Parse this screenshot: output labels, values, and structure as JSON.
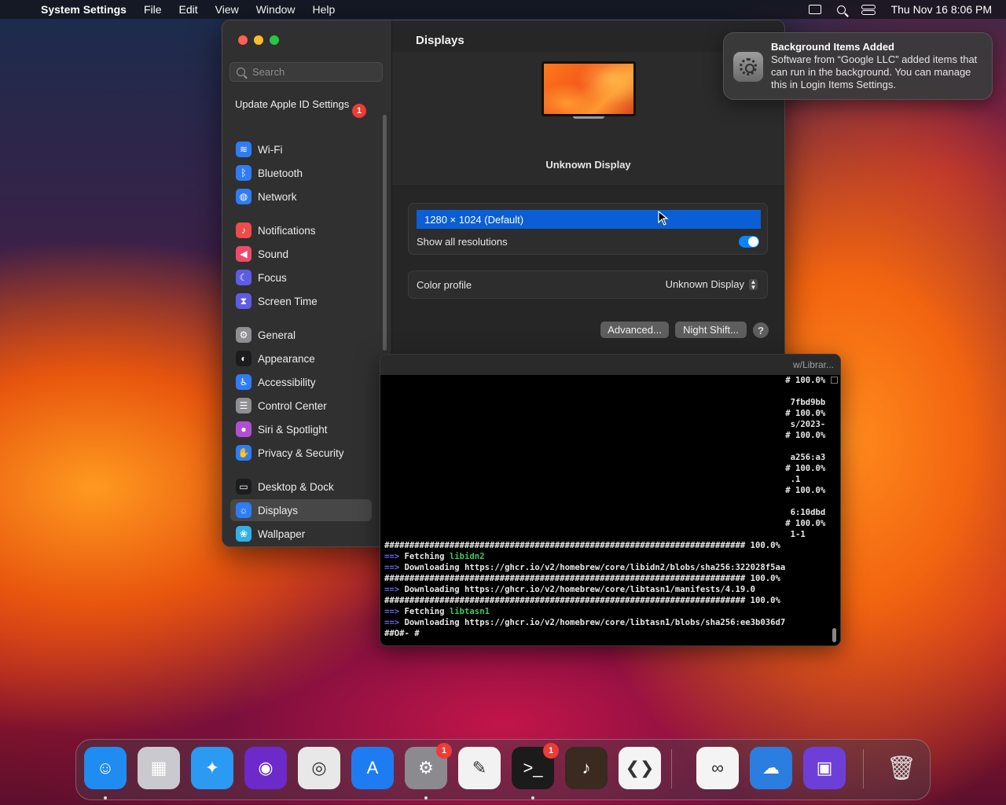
{
  "menubar": {
    "apple": "",
    "app_name": "System Settings",
    "menus": [
      "File",
      "Edit",
      "View",
      "Window",
      "Help"
    ],
    "clock": "Thu Nov 16  8:06 PM"
  },
  "sidebar": {
    "search_placeholder": "Search",
    "apple_id": "Update Apple ID Settings",
    "apple_id_badge": "1",
    "items": [
      {
        "label": "Wi-Fi",
        "icon": "wifi-icon",
        "color": "#2f7cf6"
      },
      {
        "label": "Bluetooth",
        "icon": "bluetooth-icon",
        "color": "#2f7cf6"
      },
      {
        "label": "Network",
        "icon": "globe-icon",
        "color": "#2f7cf6"
      },
      {
        "label": "Notifications",
        "icon": "bell-icon",
        "color": "#ee4b4b"
      },
      {
        "label": "Sound",
        "icon": "speaker-icon",
        "color": "#ee4b6a"
      },
      {
        "label": "Focus",
        "icon": "moon-icon",
        "color": "#5e5ce6"
      },
      {
        "label": "Screen Time",
        "icon": "hourglass-icon",
        "color": "#5e5ce6"
      },
      {
        "label": "General",
        "icon": "gear-icon",
        "color": "#8e8e93"
      },
      {
        "label": "Appearance",
        "icon": "appearance-icon",
        "color": "#1c1c1e"
      },
      {
        "label": "Accessibility",
        "icon": "accessibility-icon",
        "color": "#2f7cf6"
      },
      {
        "label": "Control Center",
        "icon": "control-center-icon",
        "color": "#8e8e93"
      },
      {
        "label": "Siri & Spotlight",
        "icon": "siri-icon",
        "color": "#b04fd6"
      },
      {
        "label": "Privacy & Security",
        "icon": "hand-icon",
        "color": "#2f7cf6"
      },
      {
        "label": "Desktop & Dock",
        "icon": "dock-icon",
        "color": "#1c1c1e"
      },
      {
        "label": "Displays",
        "icon": "sun-icon",
        "color": "#2f7cf6"
      },
      {
        "label": "Wallpaper",
        "icon": "wallpaper-icon",
        "color": "#30b0e6"
      }
    ]
  },
  "content": {
    "title": "Displays",
    "display_name": "Unknown Display",
    "resolution": "1280 × 1024 (Default)",
    "show_all_label": "Show all resolutions",
    "show_all_on": true,
    "color_profile_label": "Color profile",
    "color_profile_value": "Unknown Display",
    "advanced_button": "Advanced...",
    "night_shift_button": "Night Shift...",
    "help_button": "?"
  },
  "terminal": {
    "title_fragment": "w/Librar...",
    "lines": [
      {
        "text": "                                                                                # 100.0%",
        "cls": ""
      },
      {
        "text": " ",
        "cls": ""
      },
      {
        "text": "                                                                                 7fbd9bb",
        "cls": ""
      },
      {
        "text": "                                                                                # 100.0%",
        "cls": ""
      },
      {
        "text": "                                                                                 s/2023-",
        "cls": ""
      },
      {
        "text": "                                                                                # 100.0%",
        "cls": ""
      },
      {
        "text": " ",
        "cls": ""
      },
      {
        "text": "                                                                                 a256:a3",
        "cls": ""
      },
      {
        "text": "                                                                                # 100.0%",
        "cls": ""
      },
      {
        "text": "                                                                                 .1",
        "cls": ""
      },
      {
        "text": "                                                                                # 100.0%",
        "cls": ""
      },
      {
        "text": " ",
        "cls": ""
      },
      {
        "text": "                                                                                 6:10dbd",
        "cls": ""
      },
      {
        "text": "                                                                                # 100.0%",
        "cls": ""
      },
      {
        "text": "                                                                                 1-1",
        "cls": ""
      },
      {
        "text": "######################################################################## 100.0%",
        "cls": ""
      },
      {
        "text": "==> Fetching libidn2",
        "cls": "fetch"
      },
      {
        "text": "==> Downloading https://ghcr.io/v2/homebrew/core/libidn2/blobs/sha256:322028f5aa",
        "cls": "dl"
      },
      {
        "text": "######################################################################## 100.0%",
        "cls": ""
      },
      {
        "text": "==> Downloading https://ghcr.io/v2/homebrew/core/libtasn1/manifests/4.19.0",
        "cls": "dl"
      },
      {
        "text": "######################################################################## 100.0%",
        "cls": ""
      },
      {
        "text": "==> Fetching libtasn1",
        "cls": "fetch"
      },
      {
        "text": "==> Downloading https://ghcr.io/v2/homebrew/core/libtasn1/blobs/sha256:ee3b036d7",
        "cls": "dl"
      },
      {
        "text": "##O#- #",
        "cls": ""
      }
    ]
  },
  "notification": {
    "title": "Background Items Added",
    "body": "Software from “Google LLC” added items that can run in the background. You can manage this in Login Items Settings."
  },
  "dock": {
    "apps": [
      {
        "name": "finder-icon",
        "glyph": "☺",
        "bg": "#1e8cf0",
        "dot": true
      },
      {
        "name": "launchpad-icon",
        "glyph": "▦",
        "bg": "#c9c9cf",
        "dot": false
      },
      {
        "name": "safari-icon",
        "glyph": "✦",
        "bg": "#2a9af2",
        "dot": false
      },
      {
        "name": "firefox-icon",
        "glyph": "◉",
        "bg": "#6b2ac9",
        "dot": false
      },
      {
        "name": "chrome-icon",
        "glyph": "◎",
        "bg": "#e8e8e8",
        "dot": false
      },
      {
        "name": "app-store-icon",
        "glyph": "A",
        "bg": "#1e7cf2",
        "dot": false
      },
      {
        "name": "system-settings-icon",
        "glyph": "⚙",
        "bg": "#8a8a8f",
        "dot": true,
        "badge": "1"
      },
      {
        "name": "textedit-icon",
        "glyph": "✎",
        "bg": "#f2f2f2",
        "dot": false
      },
      {
        "name": "terminal-icon",
        "glyph": ">_",
        "bg": "#1b1b1b",
        "dot": true,
        "badge": "1"
      },
      {
        "name": "garageband-icon",
        "glyph": "♪",
        "bg": "#3a2a20",
        "dot": false
      },
      {
        "name": "vscode-icon",
        "glyph": "❮❯",
        "bg": "#f4f4f4",
        "dot": false
      },
      {
        "name": "visual-studio-icon",
        "glyph": "∞",
        "bg": "#f4f4f4",
        "dot": false
      },
      {
        "name": "weather-icon",
        "glyph": "☁",
        "bg": "#2b7de0",
        "dot": false
      },
      {
        "name": "installer-icon",
        "glyph": "▣",
        "bg": "#6d3fd8",
        "dot": false
      },
      {
        "name": "trash-icon",
        "glyph": "🗑",
        "bg": "transparent",
        "dot": false
      }
    ]
  }
}
